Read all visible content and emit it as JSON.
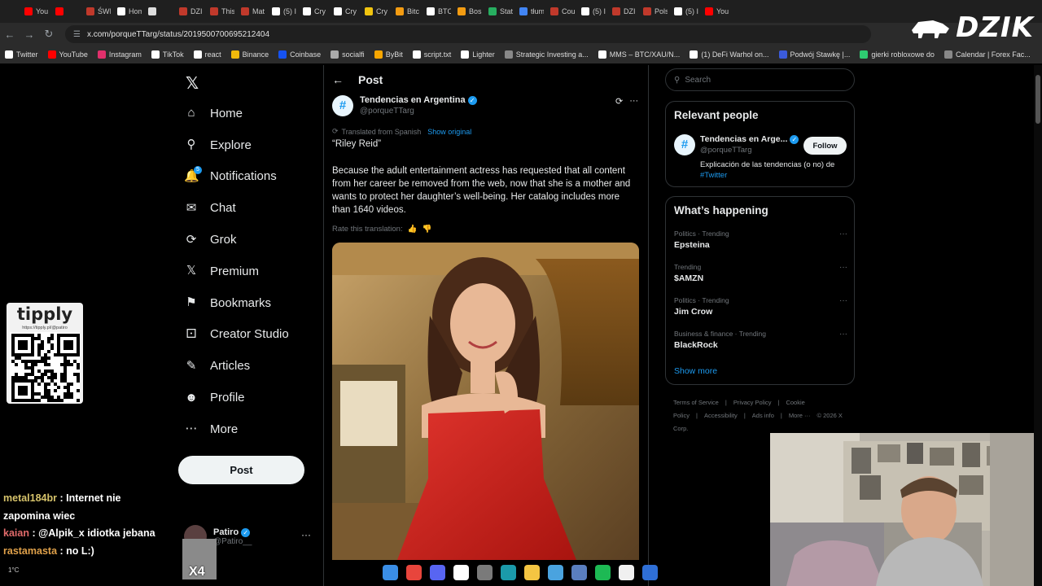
{
  "browser": {
    "tabs": [
      {
        "label": "You",
        "color": "#ff0000"
      },
      {
        "label": "",
        "color": "#ff0000"
      },
      {
        "label": "ŚWI",
        "color": "#c0392b"
      },
      {
        "label": "Hom",
        "color": "#ffffff"
      },
      {
        "label": "",
        "color": "#dddddd"
      },
      {
        "label": "DZI",
        "color": "#c0392b"
      },
      {
        "label": "This",
        "color": "#c0392b"
      },
      {
        "label": "Mat",
        "color": "#c0392b"
      },
      {
        "label": "(5) I",
        "color": "#ffffff"
      },
      {
        "label": "Cry",
        "color": "#ffffff"
      },
      {
        "label": "Cry",
        "color": "#ffffff"
      },
      {
        "label": "Cry",
        "color": "#f1c40f"
      },
      {
        "label": "Bitc",
        "color": "#f39c12"
      },
      {
        "label": "BTC",
        "color": "#ffffff"
      },
      {
        "label": "Bos",
        "color": "#f39c12"
      },
      {
        "label": "Stat",
        "color": "#27ae60"
      },
      {
        "label": "tłum",
        "color": "#4285f4"
      },
      {
        "label": "Cou",
        "color": "#c0392b"
      },
      {
        "label": "(5) I",
        "color": "#ffffff"
      },
      {
        "label": "DZI",
        "color": "#c0392b"
      },
      {
        "label": "Pols",
        "color": "#c0392b"
      },
      {
        "label": "(5) I",
        "color": "#ffffff"
      },
      {
        "label": "You",
        "color": "#ff0000"
      }
    ],
    "url": "x.com/porqueTTarg/status/2019500700695212404",
    "bookmarks": [
      {
        "label": "Twitter",
        "color": "#ffffff"
      },
      {
        "label": "YouTube",
        "color": "#ff0000"
      },
      {
        "label": "Instagram",
        "color": "#e1306c"
      },
      {
        "label": "TikTok",
        "color": "#ffffff"
      },
      {
        "label": "react",
        "color": "#ffffff"
      },
      {
        "label": "Binance",
        "color": "#f0b90b"
      },
      {
        "label": "Coinbase",
        "color": "#1652f0"
      },
      {
        "label": "socialfi",
        "color": "#aaaaaa"
      },
      {
        "label": "ByBit",
        "color": "#f7a600"
      },
      {
        "label": "script.txt",
        "color": "#ffffff"
      },
      {
        "label": "Lighter",
        "color": "#ffffff"
      },
      {
        "label": "Strategic Investing a...",
        "color": "#888888"
      },
      {
        "label": "MMS – BTC/XAU/N...",
        "color": "#ffffff"
      },
      {
        "label": "(1) DeFi Warhol on...",
        "color": "#ffffff"
      },
      {
        "label": "Podwój Stawkę |...",
        "color": "#3b5bdb"
      },
      {
        "label": "gierki robloxowe do",
        "color": "#2ecc71"
      },
      {
        "label": "Calendar | Forex Fac...",
        "color": "#888888"
      }
    ]
  },
  "overlay": {
    "brand": "DZIK",
    "tipply_logo": "tipply",
    "tipply_url": "https://tipply.pl/@patiro",
    "chat": [
      {
        "user": "metal184br",
        "text": ": Internet nie zapomina wiec"
      },
      {
        "user": "kaian",
        "text": ": @Alpik_x idiotka jebana"
      },
      {
        "user": "rastamasta",
        "text": ": no L:)"
      }
    ],
    "weather": "1°C",
    "avatar_badge": "X4"
  },
  "nav": {
    "items": [
      {
        "label": "Home",
        "icon": "home-icon"
      },
      {
        "label": "Explore",
        "icon": "search-icon"
      },
      {
        "label": "Notifications",
        "icon": "bell-icon",
        "badge": "5"
      },
      {
        "label": "Chat",
        "icon": "mail-icon"
      },
      {
        "label": "Grok",
        "icon": "grok-icon"
      },
      {
        "label": "Premium",
        "icon": "x-logo-icon"
      },
      {
        "label": "Bookmarks",
        "icon": "bookmark-icon"
      },
      {
        "label": "Creator Studio",
        "icon": "creator-icon"
      },
      {
        "label": "Articles",
        "icon": "article-icon"
      },
      {
        "label": "Profile",
        "icon": "person-icon"
      },
      {
        "label": "More",
        "icon": "more-circle-icon"
      }
    ],
    "post_button": "Post",
    "account": {
      "name": "Patiro",
      "handle": "@Patiro__"
    }
  },
  "post": {
    "header": "Post",
    "author_name": "Tendencias en Argentina",
    "author_handle": "@porqueTTarg",
    "translated_label": "Translated from Spanish",
    "show_original": "Show original",
    "quote": "“Riley Reid”",
    "body": "Because the adult entertainment actress has requested that all content from her career be removed from the web, now that she is a mother and wants to protect her daughter’s well-being. Her catalog includes more than 1640 videos.",
    "rate_label": "Rate this translation:"
  },
  "sidebar": {
    "search_placeholder": "Search",
    "relevant_title": "Relevant people",
    "relevant": {
      "name": "Tendencias en Arge...",
      "handle": "@porqueTTarg",
      "follow": "Follow",
      "bio": "Explicación de las tendencias (o no) de",
      "bio_tag": "#Twitter"
    },
    "happening_title": "What’s happening",
    "trends": [
      {
        "context": "Politics · Trending",
        "title": "Epsteina"
      },
      {
        "context": "Trending",
        "title": "$AMZN"
      },
      {
        "context": "Politics · Trending",
        "title": "Jim Crow"
      },
      {
        "context": "Business & finance · Trending",
        "title": "BlackRock"
      }
    ],
    "show_more": "Show more",
    "footer": [
      "Terms of Service",
      "|",
      "Privacy Policy",
      "|",
      "Cookie Policy",
      "|",
      "Accessibility",
      "|",
      "Ads info",
      "|",
      "More ···",
      "© 2026 X Corp."
    ]
  },
  "colors": {
    "accent": "#1d9bf0",
    "background": "#000000",
    "border": "#2f3336"
  }
}
